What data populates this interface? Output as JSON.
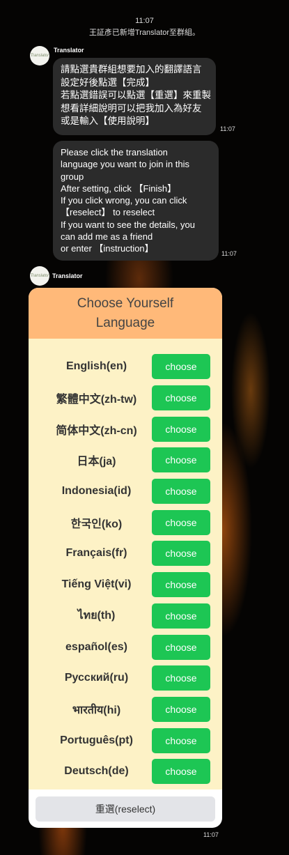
{
  "system": {
    "time": "11:07",
    "notice": "王証彥已新增Translator至群組。"
  },
  "messages": [
    {
      "sender": "Translator",
      "avatar_text": "Translator",
      "lines": [
        "請點選貴群組想要加入的翻譯語言",
        "設定好後點選【完成】",
        "若點選錯誤可以點選【重選】來重製",
        "想看詳細說明可以把我加入為好友",
        "或是輸入【使用說明】"
      ],
      "time": "11:07"
    },
    {
      "lines": [
        "Please click the translation",
        "language you want to join in this",
        "group",
        "After setting, click 【Finish】",
        "If you click wrong, you can click",
        "【reselect】 to reselect",
        "If you want to see the details, you",
        "can add me as a friend",
        "or enter 【instruction】"
      ],
      "time": "11:07"
    },
    {
      "sender": "Translator",
      "avatar_text": "Translator",
      "time": "11:07"
    }
  ],
  "card": {
    "title_line1": "Choose Yourself",
    "title_line2": "Language",
    "choose_label": "choose",
    "languages": [
      "English(en)",
      "繁體中文(zh-tw)",
      "简体中文(zh-cn)",
      "日本(ja)",
      "Indonesia(id)",
      "한국인(ko)",
      "Français(fr)",
      "Tiếng Việt(vi)",
      "ไทย(th)",
      "español(es)",
      "Русский(ru)",
      "भारतीय(hi)",
      "Português(pt)",
      "Deutsch(de)"
    ],
    "reselect_label": "重選(reselect)"
  },
  "colors": {
    "header": "#ffb979",
    "body": "#fdf2c6",
    "choose_button": "#1dc654",
    "bubble": "#2b2b2b"
  }
}
